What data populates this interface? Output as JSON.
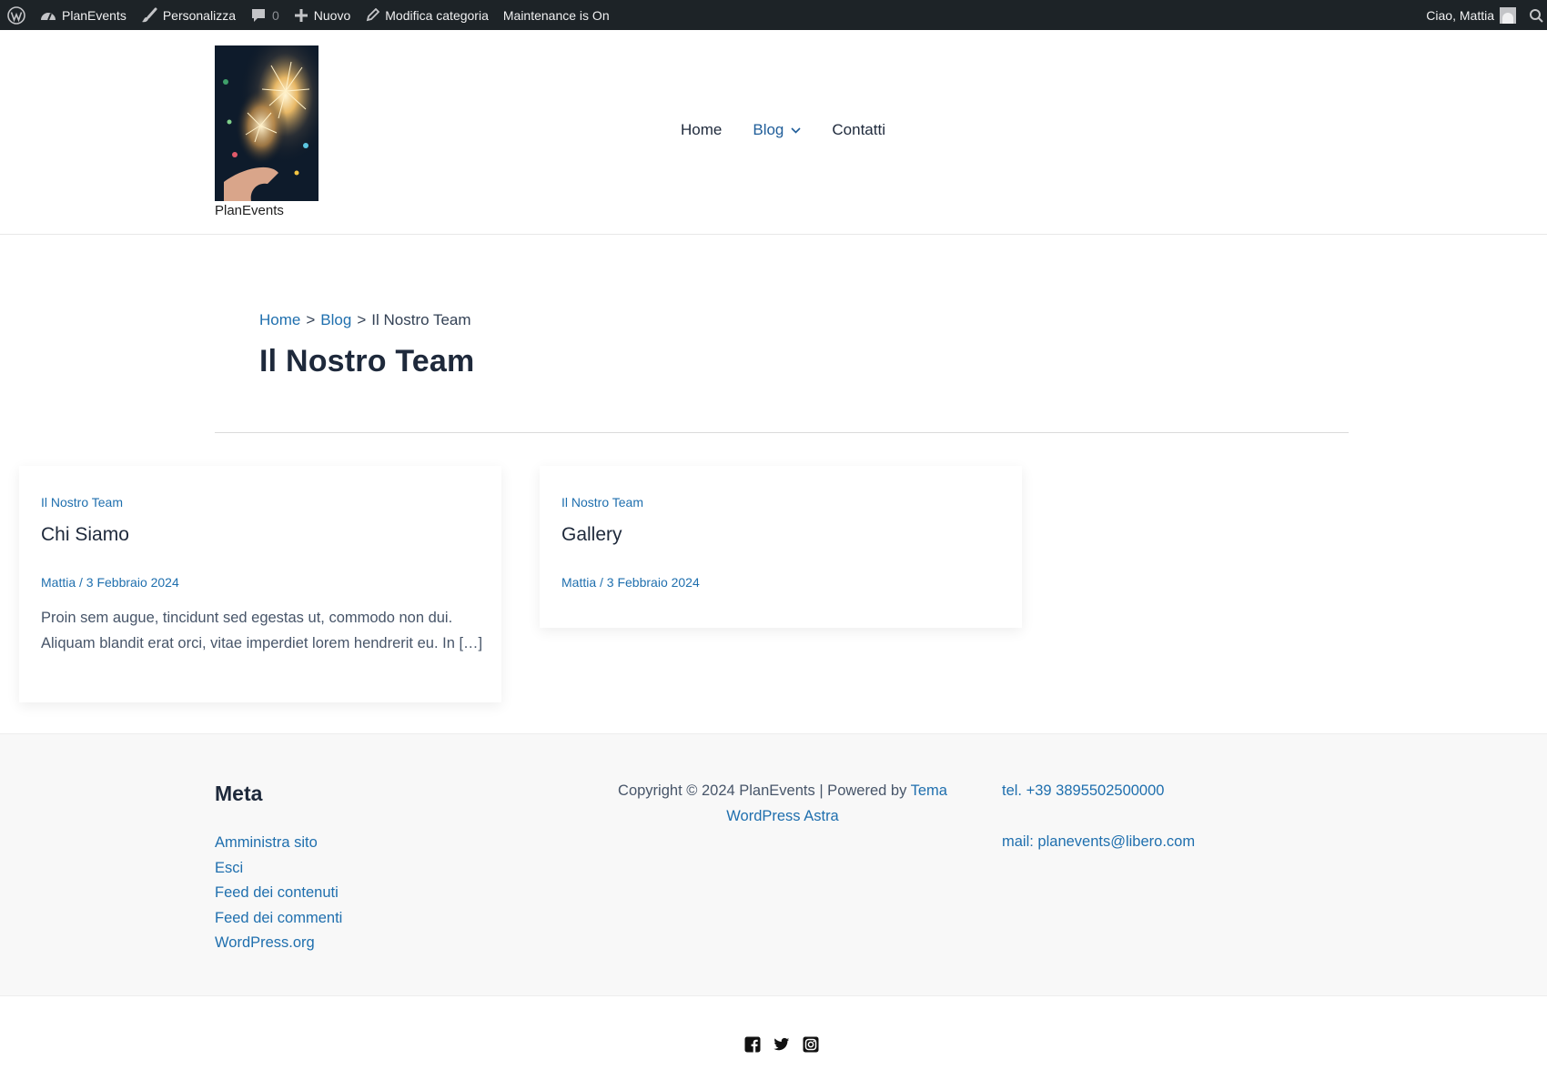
{
  "admin_bar": {
    "site_name": "PlanEvents",
    "customize": "Personalizza",
    "comments_count": "0",
    "new": "Nuovo",
    "edit_category": "Modifica categoria",
    "maintenance": "Maintenance is On",
    "greeting": "Ciao, Mattia"
  },
  "header": {
    "site_title": "PlanEvents",
    "nav": [
      {
        "label": "Home"
      },
      {
        "label": "Blog"
      },
      {
        "label": "Contatti"
      }
    ]
  },
  "breadcrumb": {
    "home": "Home",
    "sep1": ">",
    "blog": "Blog",
    "sep2": ">",
    "current": "Il Nostro Team"
  },
  "page_title": "Il Nostro Team",
  "posts": [
    {
      "category": "Il Nostro Team",
      "title": "Chi Siamo",
      "meta": "Mattia / 3 Febbraio 2024",
      "excerpt": "Proin sem augue, tincidunt sed egestas ut, commodo non dui. Aliquam blandit erat orci, vitae imperdiet lorem hendrerit eu. In […]"
    },
    {
      "category": "Il Nostro Team",
      "title": "Gallery",
      "meta": "Mattia / 3 Febbraio 2024"
    }
  ],
  "footer": {
    "meta_title": "Meta",
    "meta_links": [
      "Amministra sito",
      "Esci",
      "Feed dei contenuti",
      "Feed dei commenti",
      "WordPress.org"
    ],
    "copyright_text": "Copyright © 2024 PlanEvents | Powered by ",
    "copyright_link": "Tema WordPress Astra",
    "phone": "tel. +39 3895502500000",
    "mail": "mail: planevents@libero.com"
  },
  "socials": [
    "facebook-icon",
    "twitter-icon",
    "instagram-icon"
  ],
  "colors": {
    "admin_bar_bg": "#1d2327",
    "link": "#1f6fae",
    "heading": "#1e293b",
    "footer_bg": "#f8f8f8"
  }
}
